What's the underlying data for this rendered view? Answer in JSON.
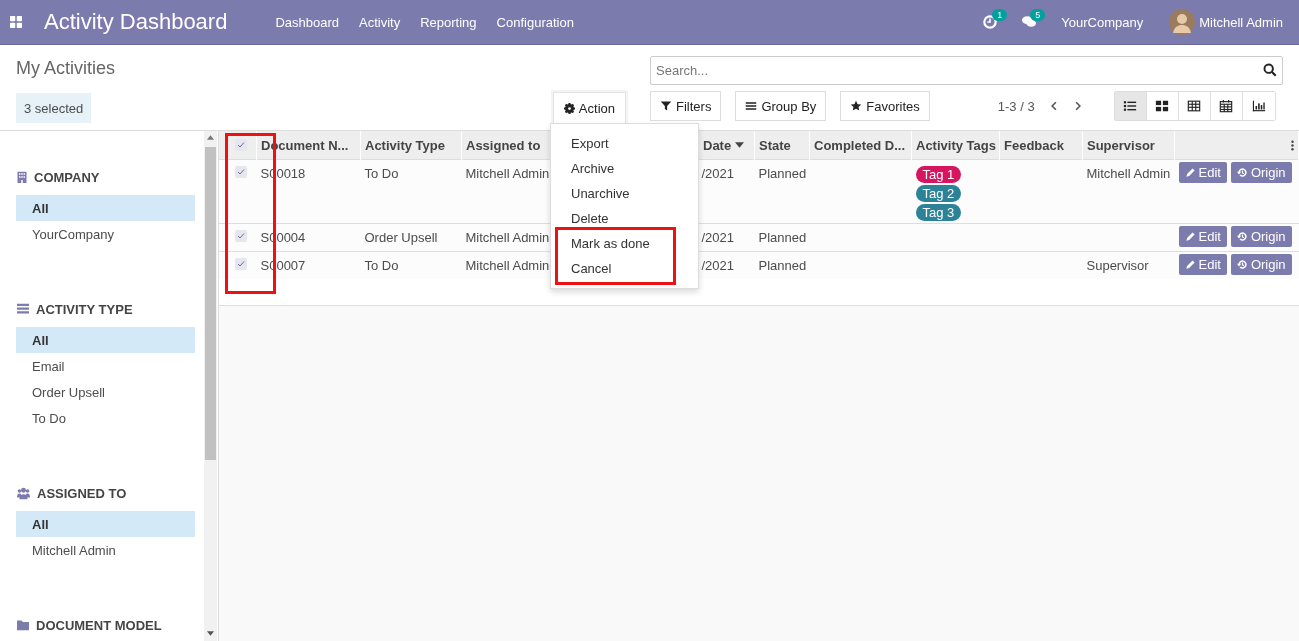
{
  "navbar": {
    "title": "Activity Dashboard",
    "menu": [
      "Dashboard",
      "Activity",
      "Reporting",
      "Configuration"
    ],
    "activity_count": "1",
    "message_count": "5",
    "company": "YourCompany",
    "user": "Mitchell Admin"
  },
  "control_panel": {
    "breadcrumb": "My Activities",
    "selection": "3 selected",
    "action_button": "Action",
    "search": {
      "placeholder": "Search..."
    },
    "filter_buttons": [
      {
        "kind": "filter",
        "label": "Filters"
      },
      {
        "kind": "group",
        "label": "Group By"
      },
      {
        "kind": "favorite",
        "label": "Favorites"
      }
    ],
    "pager": "1-3 / 3",
    "views": [
      {
        "kind": "list",
        "selected": true
      },
      {
        "kind": "kanban",
        "selected": false
      },
      {
        "kind": "pivot",
        "selected": false
      },
      {
        "kind": "calendar",
        "selected": false
      },
      {
        "kind": "graph",
        "selected": false
      }
    ]
  },
  "action_menu": {
    "items": [
      "Export",
      "Archive",
      "Unarchive",
      "Delete",
      "Mark as done",
      "Cancel"
    ]
  },
  "sidebar": {
    "sections": [
      {
        "kind": "company",
        "title": "COMPANY",
        "items": [
          {
            "label": "All",
            "selected": true
          },
          {
            "label": "YourCompany",
            "selected": false
          }
        ]
      },
      {
        "kind": "activity_type",
        "title": "ACTIVITY TYPE",
        "items": [
          {
            "label": "All",
            "selected": true
          },
          {
            "label": "Email",
            "selected": false
          },
          {
            "label": "Order Upsell",
            "selected": false
          },
          {
            "label": "To Do",
            "selected": false
          }
        ]
      },
      {
        "kind": "users",
        "title": "ASSIGNED TO",
        "items": [
          {
            "label": "All",
            "selected": true
          },
          {
            "label": "Mitchell Admin",
            "selected": false
          }
        ]
      },
      {
        "kind": "folder",
        "title": "DOCUMENT MODEL"
      }
    ]
  },
  "table": {
    "all_checked": true,
    "columns": [
      {
        "label": "Document N...",
        "sorted": false
      },
      {
        "label": "Activity Type",
        "sorted": false
      },
      {
        "label": "Assigned to",
        "sorted": false
      },
      {
        "label": "Date",
        "sorted": true
      },
      {
        "label": "State",
        "sorted": false
      },
      {
        "label": "Completed D...",
        "sorted": false
      },
      {
        "label": "Activity Tags",
        "sorted": false
      },
      {
        "label": "Feedback",
        "sorted": false
      },
      {
        "label": "Supervisor",
        "sorted": false
      }
    ],
    "rows": [
      {
        "checked": true,
        "cells": [
          "S00018",
          "To Do",
          "Mitchell Admin",
          "/2021",
          "Planned",
          "",
          null,
          "",
          "Mitchell Admin"
        ],
        "tags": [
          {
            "label": "Tag 1",
            "color": "#d6145f"
          },
          {
            "label": "Tag 2",
            "color": "#2c8397"
          },
          {
            "label": "Tag 3",
            "color": "#2c8397"
          }
        ],
        "buttons": [
          "Edit",
          "Origin"
        ]
      },
      {
        "checked": true,
        "cells": [
          "S00004",
          "Order Upsell",
          "Mitchell Admin",
          "/2021",
          "Planned",
          "",
          null,
          "",
          ""
        ],
        "tags": [],
        "buttons": [
          "Edit",
          "Origin"
        ]
      },
      {
        "checked": true,
        "cells": [
          "S00007",
          "To Do",
          "Mitchell Admin",
          "/2021",
          "Planned",
          "",
          null,
          "",
          "Supervisor"
        ],
        "tags": [],
        "buttons": [
          "Edit",
          "Origin"
        ]
      }
    ]
  }
}
